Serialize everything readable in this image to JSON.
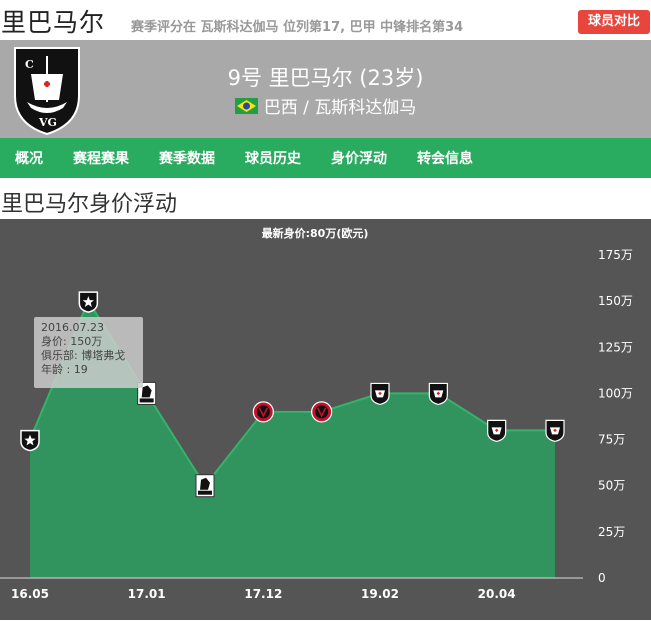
{
  "header": {
    "player_name": "里巴马尔",
    "season_desc": "赛季评分在 瓦斯科达伽马 位列第17, 巴甲 中锋排名第34",
    "compare_button": "球员对比"
  },
  "profile": {
    "player_line": "9号 里巴马尔 (23岁)",
    "club_line": "巴西 / 瓦斯科达伽马",
    "logo_icon": "vasco-da-gama-crest-icon",
    "flag_icon": "brazil-flag-icon"
  },
  "nav": {
    "tabs": [
      "概况",
      "赛程赛果",
      "赛季数据",
      "球员历史",
      "身价浮动",
      "转会信息"
    ]
  },
  "section": {
    "title": "里巴马尔身价浮动"
  },
  "colors": {
    "nav_green": "#29ab60",
    "compare_red": "#e8453c",
    "header_gray": "#a9a9a9",
    "chart_bg": "#555555",
    "area_fill": "#2e9a5e",
    "area_line": "#35b36a"
  },
  "chart_data": {
    "type": "area",
    "title": "最新身价:80万(欧元)",
    "x_tick_labels": [
      "16.05",
      "17.01",
      "17.12",
      "19.02",
      "20.04"
    ],
    "y_tick_labels": [
      "175万",
      "150万",
      "125万",
      "100万",
      "75万",
      "50万",
      "25万",
      "0"
    ],
    "ylim": [
      0,
      175
    ],
    "y_unit": "万",
    "points": [
      {
        "x": 0,
        "value": 75,
        "club_icon": "botafogo-badge-icon"
      },
      {
        "x": 1,
        "value": 150,
        "club_icon": "botafogo-badge-icon"
      },
      {
        "x": 2,
        "value": 100,
        "club_icon": "munich-1860-badge-icon"
      },
      {
        "x": 3,
        "value": 50,
        "club_icon": "munich-1860-badge-icon"
      },
      {
        "x": 4,
        "value": 90,
        "club_icon": "atletico-paranaense-badge-icon"
      },
      {
        "x": 5,
        "value": 90,
        "club_icon": "atletico-paranaense-badge-icon"
      },
      {
        "x": 6,
        "value": 100,
        "club_icon": "vasco-badge-icon"
      },
      {
        "x": 7,
        "value": 100,
        "club_icon": "vasco-badge-icon"
      },
      {
        "x": 8,
        "value": 80,
        "club_icon": "vasco-badge-icon"
      },
      {
        "x": 9,
        "value": 80,
        "club_icon": "vasco-badge-icon"
      }
    ],
    "tooltip": {
      "date": "2016.07.23",
      "value": "身价: 150万",
      "club": "俱乐部: 博塔弗戈",
      "age": "年龄 : 19"
    }
  }
}
